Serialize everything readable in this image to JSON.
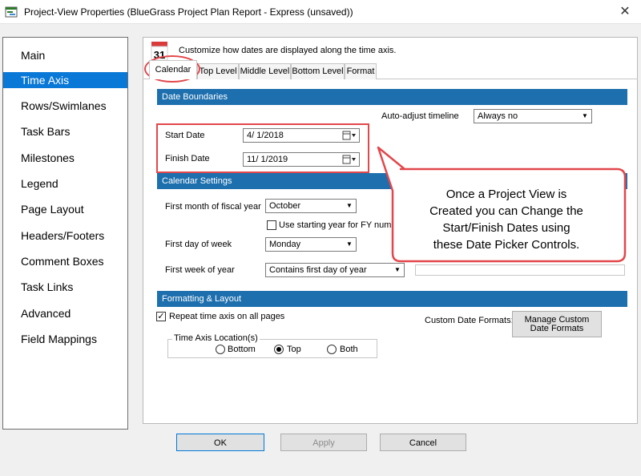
{
  "window": {
    "title": "Project-View Properties (BlueGrass Project Plan Report - Express (unsaved))",
    "close_glyph": "✕"
  },
  "sidebar": {
    "items": [
      {
        "label": "Main"
      },
      {
        "label": "Time Axis",
        "selected": true
      },
      {
        "label": "Rows/Swimlanes"
      },
      {
        "label": "Task Bars"
      },
      {
        "label": "Milestones"
      },
      {
        "label": "Legend"
      },
      {
        "label": "Page Layout"
      },
      {
        "label": "Headers/Footers"
      },
      {
        "label": "Comment Boxes"
      },
      {
        "label": "Task Links"
      },
      {
        "label": "Advanced"
      },
      {
        "label": "Field Mappings"
      }
    ]
  },
  "header": {
    "calendar_icon_day": "31",
    "description": "Customize how dates are displayed along the time axis."
  },
  "tabs": [
    {
      "label": "Calendar",
      "selected": true
    },
    {
      "label": "Top Level"
    },
    {
      "label": "Middle Level"
    },
    {
      "label": "Bottom Level"
    },
    {
      "label": "Format"
    }
  ],
  "date_boundaries": {
    "section_title": "Date Boundaries",
    "auto_adjust_label": "Auto-adjust timeline",
    "auto_adjust_value": "Always no",
    "start_label": "Start Date",
    "start_value": "4/  1/2018",
    "finish_label": "Finish Date",
    "finish_value": "11/  1/2019"
  },
  "calendar_settings": {
    "section_title": "Calendar Settings",
    "fiscal_year_label": "First month of fiscal year",
    "fiscal_year_value": "October",
    "fy_checkbox_label": "Use starting year for FY number",
    "fy_checkbox_checked": false,
    "first_day_label": "First day of week",
    "first_day_value": "Monday",
    "first_week_label": "First week of year",
    "first_week_value": "Contains first day of year"
  },
  "formatting": {
    "section_title": "Formatting & Layout",
    "repeat_label": "Repeat time axis on all pages",
    "repeat_checked": true,
    "repeat_check_glyph": "✓",
    "custom_formats_label": "Custom Date Formats:",
    "manage_button_line1": "Manage  Custom",
    "manage_button_line2": "Date Formats",
    "axis_location_title": "Time Axis Location(s)",
    "options": [
      {
        "label": "Bottom",
        "selected": false
      },
      {
        "label": "Top",
        "selected": true
      },
      {
        "label": "Both",
        "selected": false
      }
    ]
  },
  "buttons": {
    "ok": "OK",
    "apply": "Apply",
    "cancel": "Cancel"
  },
  "callout": {
    "line1": "Once a Project View is",
    "line2": "Created you can Change the",
    "line3": "Start/Finish Dates using",
    "line4": "these Date Picker Controls."
  },
  "colors": {
    "accent": "#0a78d7",
    "section_header": "#1d6fae",
    "annotation_red": "#e2474b"
  }
}
